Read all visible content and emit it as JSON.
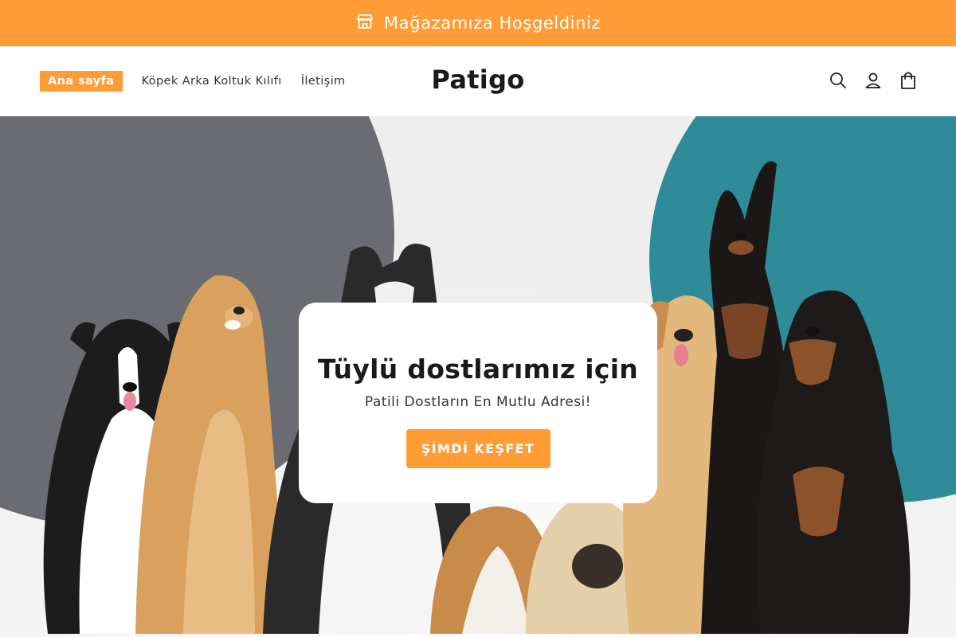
{
  "colors": {
    "accent": "#FF9C35",
    "hero_bg": "#F2F2F2",
    "gray_circle": "#6B6C72",
    "teal_circle": "#2E8B97",
    "text_dark": "#121212"
  },
  "announcement": {
    "icon": "store-icon",
    "text": "Mağazamıza Hoşgeldiniz"
  },
  "header": {
    "nav": [
      {
        "label": "Ana sayfa",
        "active": true
      },
      {
        "label": "Köpek Arka Koltuk Kılıfı",
        "active": false
      },
      {
        "label": "İletişim",
        "active": false
      }
    ],
    "logo": "Patigo",
    "icons": [
      "search-icon",
      "account-icon",
      "cart-icon"
    ]
  },
  "hero": {
    "image": "group of dogs on white background",
    "title": "Tüylü dostlarımız için",
    "subtitle": "Patili Dostların En Mutlu Adresi!",
    "cta_label": "ŞİMDİ KEŞFET"
  }
}
